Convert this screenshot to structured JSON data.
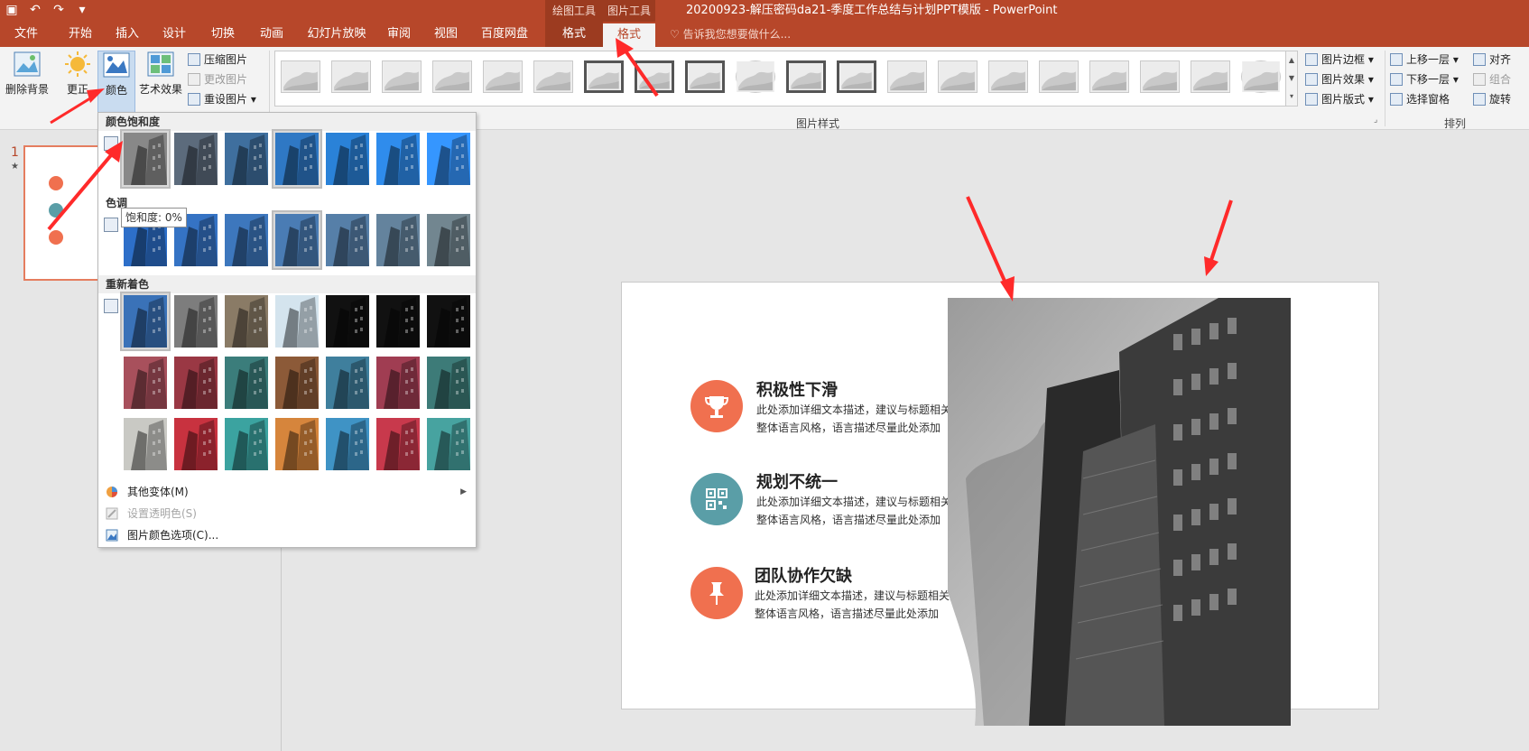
{
  "titlebar": {
    "context_group_draw": "绘图工具",
    "context_group_picture": "图片工具",
    "document_title": "20200923-解压密码da21-季度工作总结与计划PPT模版 - PowerPoint"
  },
  "tabs": {
    "file": "文件",
    "home": "开始",
    "insert": "插入",
    "design": "设计",
    "transitions": "切换",
    "animations": "动画",
    "slideshow": "幻灯片放映",
    "review": "审阅",
    "view": "视图",
    "baidu": "百度网盘",
    "drawing_format": "格式",
    "picture_format": "格式",
    "tell_me": "告诉我您想要做什么..."
  },
  "ribbon": {
    "remove_background": "删除背景",
    "corrections": "更正",
    "color": "颜色",
    "artistic_effects": "艺术效果",
    "compress_pictures": "压缩图片",
    "change_picture": "更改图片",
    "reset_picture": "重设图片",
    "picture_styles_label": "图片样式",
    "picture_border": "图片边框",
    "picture_effects": "图片效果",
    "picture_layout": "图片版式",
    "bring_forward": "上移一层",
    "send_backward": "下移一层",
    "selection_pane": "选择窗格",
    "align": "对齐",
    "group": "组合",
    "rotate": "旋转",
    "arrange_label": "排列"
  },
  "thumbnail": {
    "slide_number": "1",
    "star": "★"
  },
  "slide": {
    "items": [
      {
        "title": "积极性下滑",
        "text": "此处添加详细文本描述，建议与标题相关并符合整体语言风格，语言描述尽量此处添加",
        "color": "#f0704f",
        "icon": "trophy-icon"
      },
      {
        "title": "规划不统一",
        "text": "此处添加详细文本描述，建议与标题相关并符合整体语言风格，语言描述尽量此处添加",
        "color": "#5a9ea7",
        "icon": "qrcode-icon"
      },
      {
        "title": "团队协作欠缺",
        "text": "此处添加详细文本描述，建议与标题相关并符合整体语言风格，语言描述尽量此处添加",
        "color": "#f0704f",
        "icon": "pushpin-icon"
      }
    ]
  },
  "dropdown": {
    "saturation_header": "颜色饱和度",
    "tone_header": "色调",
    "recolor_header": "重新着色",
    "tooltip": "饱和度: 0%",
    "more_variations": "其他变体(M)",
    "set_transparent": "设置透明色(S)",
    "color_options": "图片颜色选项(C)...",
    "saturation_swatches": [
      "#888888",
      "#5c6b7c",
      "#3f6f9e",
      "#2f78c4",
      "#2a82d8",
      "#2f8cec",
      "#3596ff"
    ],
    "tone_swatches": [
      "#2d6fc9",
      "#3573c4",
      "#3d77bd",
      "#4a7cb4",
      "#567fa8",
      "#64839d",
      "#728690"
    ],
    "recolor_swatches": [
      [
        "#3a72b8",
        "#7d7d7d",
        "#8a7b66",
        "#d4e4ee",
        "#111111",
        "#111111",
        "#111111"
      ],
      [
        "#a8505c",
        "#9a3844",
        "#3b7d7b",
        "#8c5a38",
        "#3f7f9d",
        "#a03d52",
        "#3d7b78"
      ],
      [
        "#c9c9c4",
        "#c8323f",
        "#3ba3a0",
        "#d6853c",
        "#3f93c5",
        "#c8394c",
        "#47a3a0"
      ]
    ]
  }
}
